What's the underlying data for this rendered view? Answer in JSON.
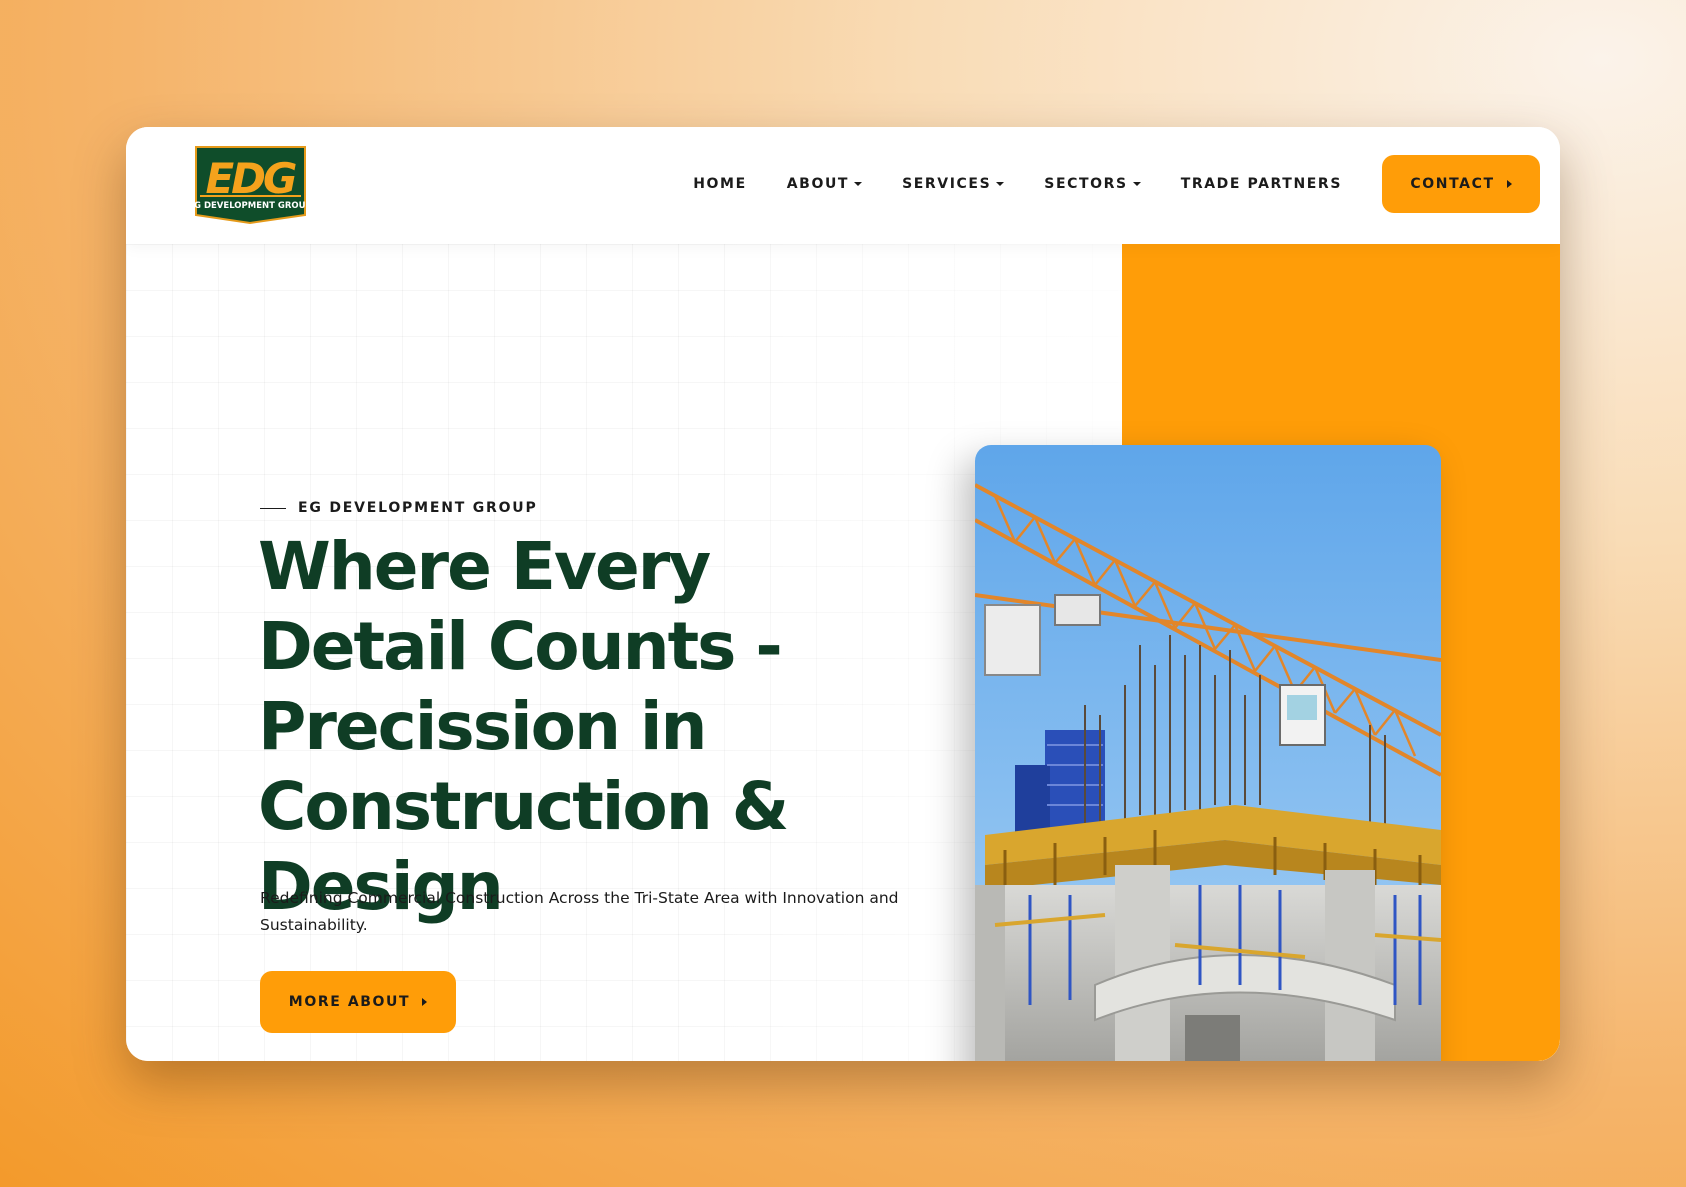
{
  "brand": {
    "logo_letters": "EDG",
    "logo_tagline": "EG DEVELOPMENT GROUP"
  },
  "nav": {
    "items": [
      {
        "label": "HOME",
        "dropdown": false
      },
      {
        "label": "ABOUT",
        "dropdown": true
      },
      {
        "label": "SERVICES",
        "dropdown": true
      },
      {
        "label": "SECTORS",
        "dropdown": true
      },
      {
        "label": "TRADE PARTNERS",
        "dropdown": false
      }
    ],
    "contact_label": "CONTACT"
  },
  "hero": {
    "eyebrow": "EG DEVELOPMENT GROUP",
    "headline": "Where Every Detail Counts - Precission in Construction & Design",
    "subtext": "Redefining Commercial Construction Across the Tri-State Area with Innovation and Sustainability.",
    "cta_label": "MORE ABOUT"
  },
  "colors": {
    "accent": "#ff9d08",
    "brand_green": "#0f3d25",
    "text": "#1b1b1b"
  },
  "icons": {
    "caret": "caret-down-icon",
    "arrow": "triangle-right-icon"
  }
}
